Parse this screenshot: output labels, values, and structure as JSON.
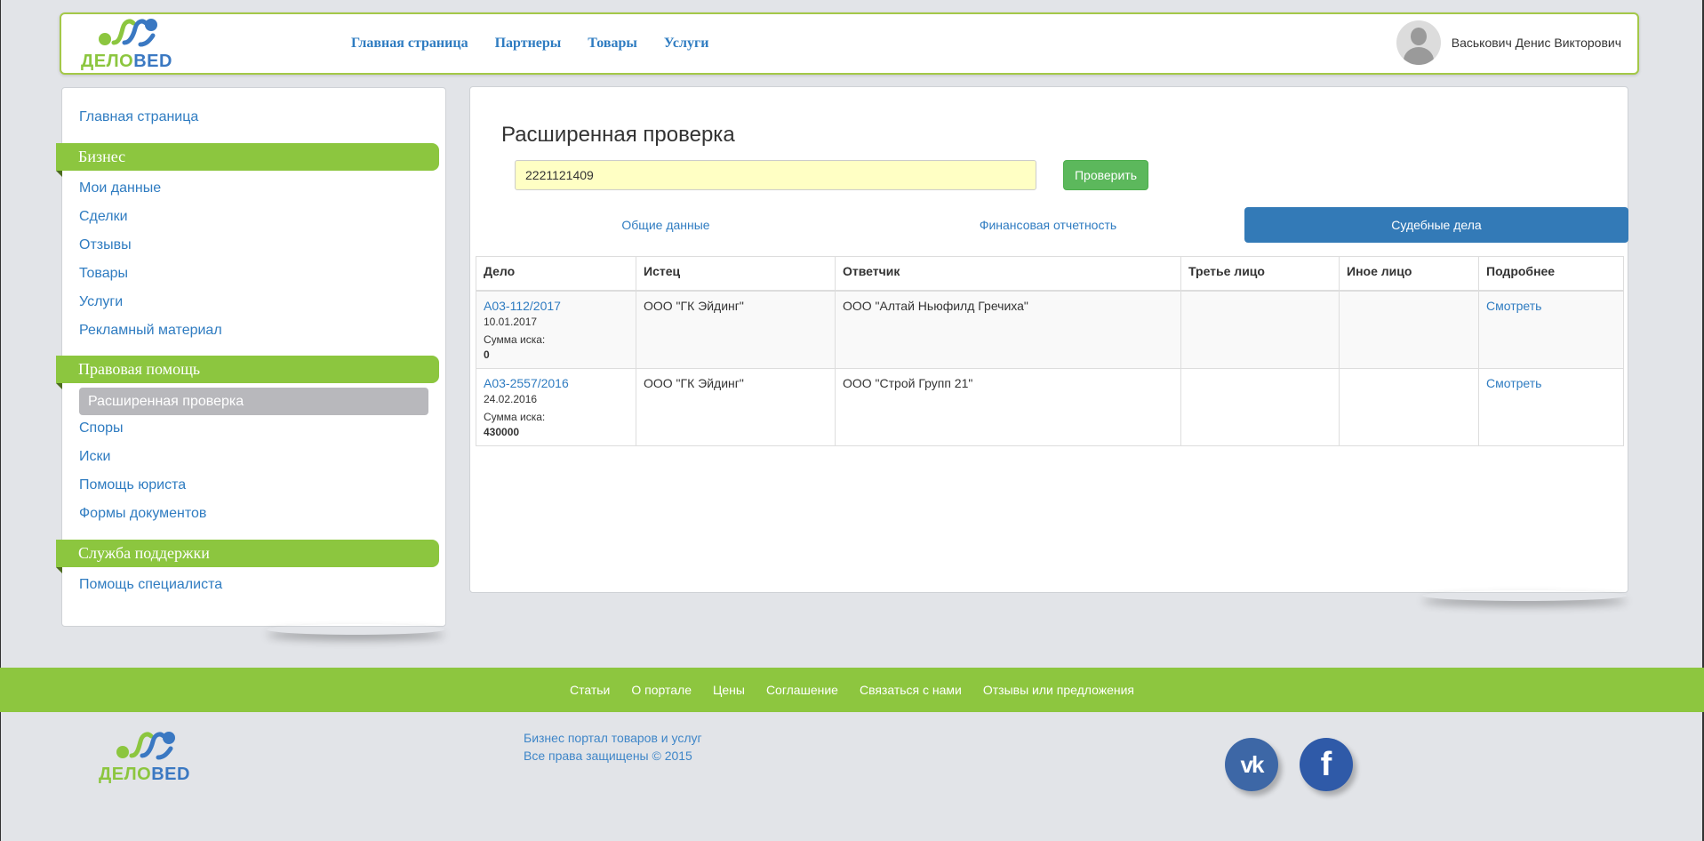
{
  "brand": {
    "word_part1": "ДЕЛО",
    "word_part2": "BED"
  },
  "topnav": [
    {
      "label": "Главная страница"
    },
    {
      "label": "Партнеры"
    },
    {
      "label": "Товары"
    },
    {
      "label": "Услуги"
    }
  ],
  "user": {
    "name": "Васькович Денис Викторович",
    "avatar_icon": "user-silhouette-icon"
  },
  "sidebar": {
    "home_link": "Главная страница",
    "sections": [
      {
        "title": "Бизнес",
        "items": [
          "Мои данные",
          "Сделки",
          "Отзывы",
          "Товары",
          "Услуги",
          "Рекламный материал"
        ]
      },
      {
        "title": "Правовая помощь",
        "active_item": "Расширенная проверка",
        "items": [
          "Споры",
          "Иски",
          "Помощь юриста",
          "Формы документов"
        ]
      },
      {
        "title": "Служба поддержки",
        "items": [
          "Помощь специалиста"
        ]
      }
    ]
  },
  "main": {
    "title": "Расширенная проверка",
    "search_value": "2221121409",
    "check_button": "Проверить",
    "tabs": [
      {
        "label": "Общие данные",
        "active": false
      },
      {
        "label": "Финансовая отчетность",
        "active": false
      },
      {
        "label": "Судебные дела",
        "active": true
      }
    ],
    "table": {
      "headers": [
        "Дело",
        "Истец",
        "Ответчик",
        "Третье лицо",
        "Иное лицо",
        "Подробнее"
      ],
      "rows": [
        {
          "case": "А03-112/2017",
          "date": "10.01.2017",
          "sum_label": "Сумма иска:",
          "sum": "0",
          "plaintiff": "ООО \"ГК Эйдинг\"",
          "defendant": "ООО \"Алтай Ньюфилд Гречиха\"",
          "third": "",
          "other": "",
          "details": "Смотреть"
        },
        {
          "case": "А03-2557/2016",
          "date": "24.02.2016",
          "sum_label": "Сумма иска:",
          "sum": "430000",
          "plaintiff": "ООО \"ГК Эйдинг\"",
          "defendant": "ООО \"Строй Групп 21\"",
          "third": "",
          "other": "",
          "details": "Смотреть"
        }
      ]
    }
  },
  "footer": {
    "links": [
      "Статьи",
      "О портале",
      "Цены",
      "Соглашение",
      "Связаться с нами",
      "Отзывы или предложения"
    ],
    "line1": "Бизнес портал товаров и услуг",
    "line2": "Все права защищены © 2015",
    "social": [
      {
        "name": "vk-icon",
        "glyph": "vk"
      },
      {
        "name": "facebook-icon",
        "glyph": "f"
      }
    ]
  },
  "colors": {
    "accent_green": "#8cc63f",
    "link_blue": "#2f7cc1",
    "active_tab": "#337ab7",
    "input_bg": "#ffffc4"
  }
}
